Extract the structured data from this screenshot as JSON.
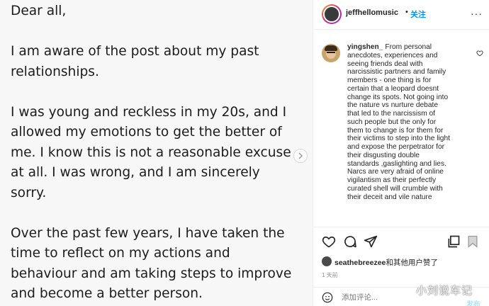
{
  "post_image": {
    "paragraphs": [
      "Dear all,",
      "I am aware of the post about my past relationships.",
      "I was young and reckless in my 20s, and I allowed my emotions to get the better of me. I know this is not a reasonable excuse at all. I was wrong, and I am sincerely sorry.",
      "Over the past few years, I have taken the time to reflect on my actions and behaviour and am taking steps to improve and become a better person."
    ],
    "lines": [
      "Dear all,",
      "I am aware of the post about my past",
      "relationships.",
      "I was young and reckless in my 20s, and I",
      "allowed my emotions to get the better of",
      "me. I know this is not a reasonable excuse",
      "at all. I was wrong, and I am sincerely",
      "sorry.",
      "Over the past few years, I have taken the",
      "time to reflect on my actions and",
      "behaviour and am taking steps to improve",
      "and become a better person."
    ],
    "next_icon": "chevron-right-icon"
  },
  "header": {
    "username": "jeffhellomusic",
    "separator": "•",
    "follow_label": "关注",
    "more_icon": "more-horizontal-icon",
    "more_label": "···"
  },
  "comment": {
    "username": "yingshen_",
    "lines": [
      "From personal",
      "anecdotes, experiences and",
      "seeing friends deal with",
      "narcissistic partners and family",
      "members - one thing is for",
      "certain that a leopard doesnt",
      "change its spots. Not going into",
      "the nature vs nurture debate",
      "that led to the narcissism of",
      "such people but the only for",
      "them to change is for them for",
      "their victims to step into the light",
      "and expose the perpetrator for",
      "their disgusting double",
      "standards ,gaslighting and lies.",
      "Narcs are very afraid of online",
      "vigilantism as their perfectly",
      "curated shell will crumble with",
      "their deceit and vile nature"
    ],
    "like_icon": "heart-outline-icon"
  },
  "actions": {
    "like_icon": "heart-icon",
    "comment_icon": "comment-icon",
    "share_icon": "send-icon",
    "collection_icon": "copy-icon",
    "save_icon": "bookmark-icon"
  },
  "likes": {
    "liker": "seathebreezee",
    "suffix": "和其他用户赞了"
  },
  "time_ago": "1 天前",
  "add_comment": {
    "placeholder": "添加评论...",
    "post_label": "发布"
  },
  "watermark": "小刘说车记",
  "colors": {
    "accent": "#0095f6",
    "text": "#262626",
    "muted": "#8e8e8e",
    "post_disabled": "#b2dffc"
  }
}
